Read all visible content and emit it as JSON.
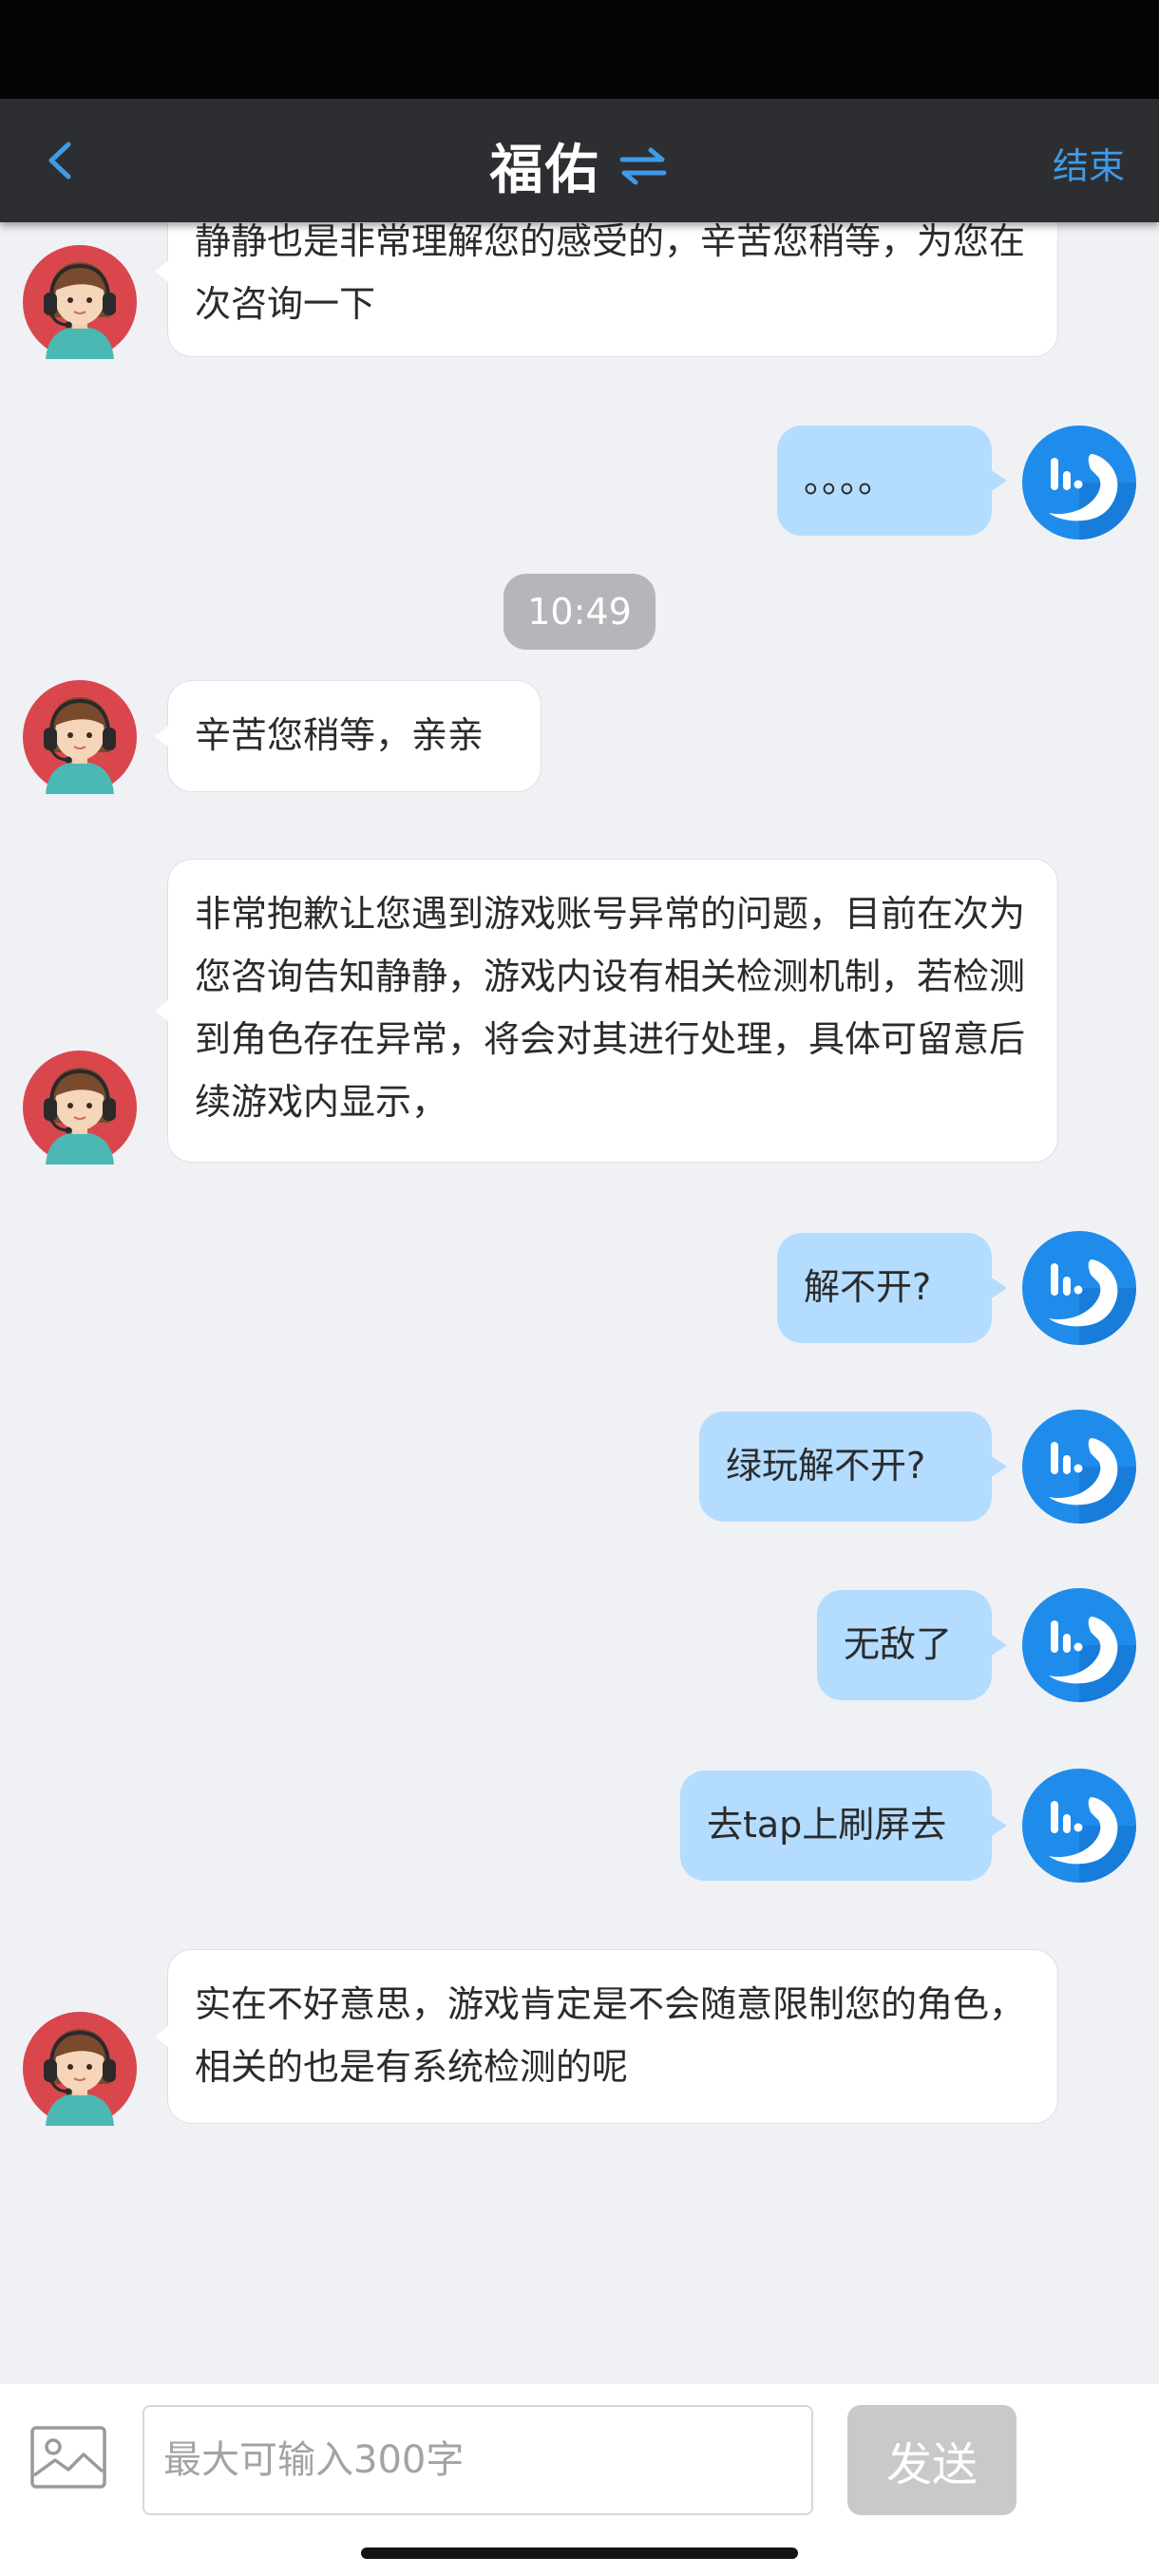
{
  "header": {
    "title": "福佑",
    "end_label": "结束"
  },
  "messages": [
    {
      "sender": "agent",
      "text": "静静也是非常理解您的感受的，辛苦您稍等，为您在次咨询一下"
    },
    {
      "sender": "user",
      "text": "。。。。"
    },
    {
      "type": "timestamp",
      "text": "10:49"
    },
    {
      "sender": "agent",
      "text": "辛苦您稍等，亲亲"
    },
    {
      "sender": "agent",
      "text": "非常抱歉让您遇到游戏账号异常的问题，目前在次为您咨询告知静静，游戏内设有相关检测机制，若检测到角色存在异常，将会对其进行处理，具体可留意后续游戏内显示，"
    },
    {
      "sender": "user",
      "text": "解不开?"
    },
    {
      "sender": "user",
      "text": "绿玩解不开?"
    },
    {
      "sender": "user",
      "text": "无敌了"
    },
    {
      "sender": "user",
      "text": "去tap上刷屏去"
    },
    {
      "sender": "agent",
      "text": "实在不好意思，游戏肯定是不会随意限制您的角色，相关的也是有系统检测的呢"
    }
  ],
  "input": {
    "placeholder": "最大可输入300字",
    "value": "",
    "send_label": "发送"
  },
  "icons": {
    "back": "chevron-left-icon",
    "switch": "swap-arrows-icon",
    "agent_avatar": "customer-service-avatar",
    "user_avatar": "phone-logo-avatar",
    "image": "image-icon"
  },
  "colors": {
    "header_bg": "#2d2e31",
    "accent": "#3e9be8",
    "user_bubble": "#b3dcff",
    "agent_bubble": "#ffffff",
    "chat_bg": "#f0f1f5",
    "send_disabled": "#c9c9cb"
  }
}
